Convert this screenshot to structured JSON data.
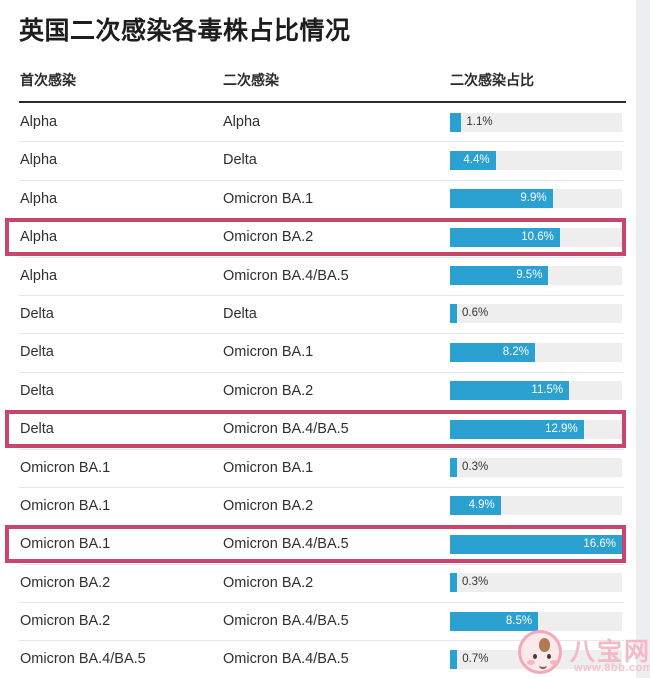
{
  "title": "英国二次感染各毒株占比情况",
  "columns": {
    "primary": "首次感染",
    "secondary": "二次感染",
    "share": "二次感染占比"
  },
  "accent_color": "#2ba1d1",
  "highlight_color": "#c8456b",
  "track_color": "#eeeeee",
  "watermark": {
    "brand": "八宝网",
    "url": "www.8bb.com"
  },
  "chart_data": {
    "type": "bar",
    "title": "英国二次感染各毒株占比情况",
    "xlabel": "",
    "ylabel": "",
    "orientation": "horizontal",
    "value_suffix": "%",
    "xlim": [
      0,
      16.6
    ],
    "grid": false,
    "legend": null,
    "categories": [
      "Alpha → Alpha",
      "Alpha → Delta",
      "Alpha → Omicron BA.1",
      "Alpha → Omicron BA.2",
      "Alpha → Omicron BA.4/BA.5",
      "Delta → Delta",
      "Delta → Omicron BA.1",
      "Delta → Omicron BA.2",
      "Delta → Omicron BA.4/BA.5",
      "Omicron BA.1 → Omicron BA.1",
      "Omicron BA.1 → Omicron BA.2",
      "Omicron BA.1 → Omicron BA.4/BA.5",
      "Omicron BA.2 → Omicron BA.2",
      "Omicron BA.2 → Omicron BA.4/BA.5",
      "Omicron BA.4/BA.5 → Omicron BA.4/BA.5"
    ],
    "values": [
      1.1,
      4.4,
      9.9,
      10.6,
      9.5,
      0.6,
      8.2,
      11.5,
      12.9,
      0.3,
      4.9,
      16.6,
      0.3,
      8.5,
      0.7
    ],
    "rows": [
      {
        "primary": "Alpha",
        "secondary": "Alpha",
        "value": 1.1,
        "label": "1.1%",
        "highlighted": false
      },
      {
        "primary": "Alpha",
        "secondary": "Delta",
        "value": 4.4,
        "label": "4.4%",
        "highlighted": false
      },
      {
        "primary": "Alpha",
        "secondary": "Omicron BA.1",
        "value": 9.9,
        "label": "9.9%",
        "highlighted": false
      },
      {
        "primary": "Alpha",
        "secondary": "Omicron BA.2",
        "value": 10.6,
        "label": "10.6%",
        "highlighted": true
      },
      {
        "primary": "Alpha",
        "secondary": "Omicron BA.4/BA.5",
        "value": 9.5,
        "label": "9.5%",
        "highlighted": false
      },
      {
        "primary": "Delta",
        "secondary": "Delta",
        "value": 0.6,
        "label": "0.6%",
        "highlighted": false
      },
      {
        "primary": "Delta",
        "secondary": "Omicron BA.1",
        "value": 8.2,
        "label": "8.2%",
        "highlighted": false
      },
      {
        "primary": "Delta",
        "secondary": "Omicron BA.2",
        "value": 11.5,
        "label": "11.5%",
        "highlighted": false
      },
      {
        "primary": "Delta",
        "secondary": "Omicron BA.4/BA.5",
        "value": 12.9,
        "label": "12.9%",
        "highlighted": true
      },
      {
        "primary": "Omicron BA.1",
        "secondary": "Omicron BA.1",
        "value": 0.3,
        "label": "0.3%",
        "highlighted": false
      },
      {
        "primary": "Omicron BA.1",
        "secondary": "Omicron BA.2",
        "value": 4.9,
        "label": "4.9%",
        "highlighted": false
      },
      {
        "primary": "Omicron BA.1",
        "secondary": "Omicron BA.4/BA.5",
        "value": 16.6,
        "label": "16.6%",
        "highlighted": true
      },
      {
        "primary": "Omicron BA.2",
        "secondary": "Omicron BA.2",
        "value": 0.3,
        "label": "0.3%",
        "highlighted": false
      },
      {
        "primary": "Omicron BA.2",
        "secondary": "Omicron BA.4/BA.5",
        "value": 8.5,
        "label": "8.5%",
        "highlighted": false
      },
      {
        "primary": "Omicron BA.4/BA.5",
        "secondary": "Omicron BA.4/BA.5",
        "value": 0.7,
        "label": "0.7%",
        "highlighted": false
      }
    ]
  }
}
